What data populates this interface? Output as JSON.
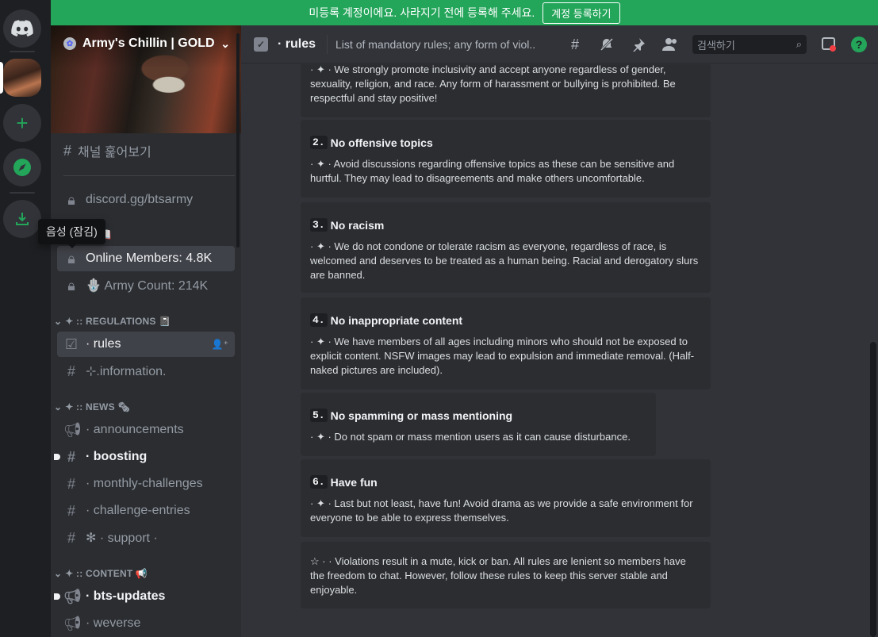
{
  "notice": {
    "text": "미등록 계정이에요. 사라지기 전에 등록해 주세요.",
    "button": "계정 등록하기"
  },
  "rail": {
    "tooltip": "음성 (잠김)"
  },
  "server": {
    "name": "Army's Chillin | GOLD..."
  },
  "sidebar": {
    "browse_label": "채널 훑어보기",
    "locked_channels": [
      {
        "label": "discord.gg/btsarmy"
      },
      {
        "label": "s 📖"
      },
      {
        "label": "Online Members: 4.8K"
      },
      {
        "label": "🪬 Army Count: 214K"
      }
    ],
    "categories": {
      "regulations": "✦ :: REGULATIONS 📓",
      "news": "✦ :: NEWS 🗞",
      "content": "✦ :: CONTENT 📢"
    },
    "channels": {
      "rules": "· rules",
      "information": "⊹.information.",
      "announcements": "· announcements",
      "boosting": "· boosting",
      "monthly": "· monthly-challenges",
      "challenge": "· challenge-entries",
      "support": "✻ · support ·",
      "bts_updates": "· bts-updates",
      "weverse": "· weverse"
    }
  },
  "header": {
    "title": "· rules",
    "topic": "List of mandatory rules; any form of viol...",
    "search_placeholder": "검색하기"
  },
  "rules": [
    {
      "number": "",
      "title": "",
      "text": "· ✦ · We strongly promote inclusivity and accept anyone regardless of gender, sexuality, religion, and race. Any form of harassment or bullying is prohibited. Be respectful and stay positive!"
    },
    {
      "number": "2.",
      "title": "No offensive topics",
      "text": "· ✦ · Avoid discussions regarding offensive topics as these can be sensitive and hurtful. They may lead to disagreements and make others uncomfortable."
    },
    {
      "number": "3.",
      "title": "No racism",
      "text": "· ✦ · We do not condone or tolerate racism as everyone, regardless of race, is welcomed and deserves to be treated as a human being. Racial and derogatory slurs are banned."
    },
    {
      "number": "4.",
      "title": "No inappropriate content",
      "text": "· ✦ · We have members of all ages including minors who should not be exposed to explicit content. NSFW images may lead to expulsion and immediate removal. (Half-naked pictures are included)."
    },
    {
      "number": "5.",
      "title": "No spamming or mass mentioning",
      "text": "· ✦ · Do not spam or mass mention users as it can cause disturbance."
    },
    {
      "number": "6.",
      "title": "Have fun",
      "text": "· ✦ · Last but not least, have fun! Avoid drama as we provide a safe environment for everyone to be able to express themselves."
    },
    {
      "number": "",
      "title": "",
      "text": "☆  ·   ·   Violations result in a mute, kick or ban. All rules are lenient so members have the freedom to chat. However, follow these rules to keep this server stable and enjoyable."
    }
  ]
}
